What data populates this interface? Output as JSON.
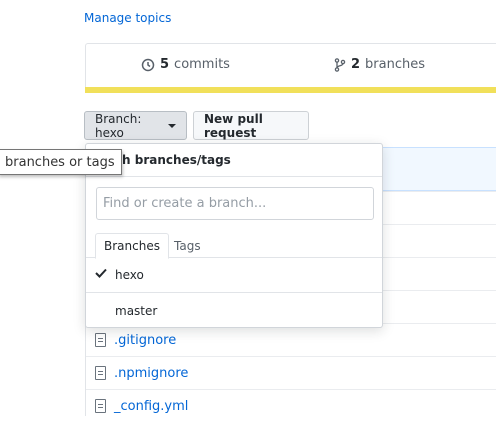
{
  "topics": {
    "manage_label": "Manage topics"
  },
  "summary": {
    "commits_count": "5",
    "commits_label": "commits",
    "branches_count": "2",
    "branches_label": "branches",
    "language_bar_color": "#f1e05a"
  },
  "toolbar": {
    "branch_button_label": "Branch: hexo",
    "new_pr_label": "New pull request"
  },
  "tooltip": {
    "text": "branches or tags"
  },
  "branch_menu": {
    "title": "witch branches/tags",
    "filter_placeholder": "Find or create a branch...",
    "tabs": [
      {
        "label": "Branches",
        "active": true
      },
      {
        "label": "Tags",
        "active": false
      }
    ],
    "items": [
      {
        "label": "hexo",
        "selected": true
      },
      {
        "label": "master",
        "selected": false
      }
    ]
  },
  "files": [
    {
      "name": ".gitignore"
    },
    {
      "name": ".npmignore"
    },
    {
      "name": "_config.yml"
    }
  ]
}
